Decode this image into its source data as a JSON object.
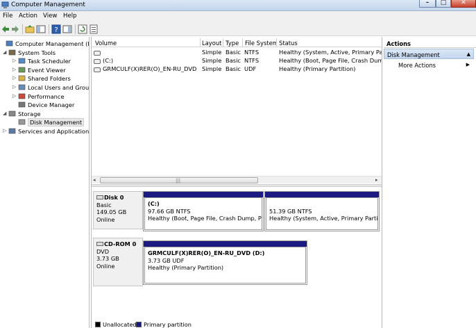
{
  "window": {
    "title": "Computer Management"
  },
  "menu": [
    "File",
    "Action",
    "View",
    "Help"
  ],
  "tree": [
    {
      "label": "Computer Management (Local",
      "level": 0,
      "icon": "computer-management-icon",
      "expander": ""
    },
    {
      "label": "System Tools",
      "level": 1,
      "icon": "system-tools-icon",
      "expander": "◢"
    },
    {
      "label": "Task Scheduler",
      "level": 2,
      "icon": "task-scheduler-icon",
      "expander": "▷"
    },
    {
      "label": "Event Viewer",
      "level": 2,
      "icon": "event-viewer-icon",
      "expander": "▷"
    },
    {
      "label": "Shared Folders",
      "level": 2,
      "icon": "shared-folders-icon",
      "expander": "▷"
    },
    {
      "label": "Local Users and Groups",
      "level": 2,
      "icon": "local-users-icon",
      "expander": "▷"
    },
    {
      "label": "Performance",
      "level": 2,
      "icon": "performance-icon",
      "expander": "▷"
    },
    {
      "label": "Device Manager",
      "level": 2,
      "icon": "device-manager-icon",
      "expander": ""
    },
    {
      "label": "Storage",
      "level": 1,
      "icon": "storage-icon",
      "expander": "◢"
    },
    {
      "label": "Disk Management",
      "level": 2,
      "icon": "disk-management-icon",
      "expander": "",
      "selected": true
    },
    {
      "label": "Services and Applications",
      "level": 1,
      "icon": "services-icon",
      "expander": "▷"
    }
  ],
  "volume_table": {
    "columns": [
      "Volume",
      "Layout",
      "Type",
      "File System",
      "Status"
    ],
    "rows": [
      {
        "volume": "",
        "layout": "Simple",
        "type": "Basic",
        "fs": "NTFS",
        "status": "Healthy (System, Active, Primary Partitic"
      },
      {
        "volume": "(C:)",
        "layout": "Simple",
        "type": "Basic",
        "fs": "NTFS",
        "status": "Healthy (Boot, Page File, Crash Dump, P"
      },
      {
        "volume": "GRMCULF(X)RER(O)_EN-RU_DVD (D:)",
        "layout": "Simple",
        "type": "Basic",
        "fs": "UDF",
        "status": "Healthy (Primary Partition)"
      }
    ]
  },
  "disks": [
    {
      "name": "Disk 0",
      "type": "Basic",
      "size": "149.05 GB",
      "state": "Online",
      "partitions": [
        {
          "name": "(C:)",
          "size": "97.66 GB NTFS",
          "status": "Healthy (Boot, Page File, Crash Dump, Prima"
        },
        {
          "name": "",
          "size": "51.39 GB NTFS",
          "status": "Healthy (System, Active, Primary Partition)"
        }
      ]
    },
    {
      "name": "CD-ROM 0",
      "type": "DVD",
      "size": "3.73 GB",
      "state": "Online",
      "partitions": [
        {
          "name": "GRMCULF(X)RER(O)_EN-RU_DVD  (D:)",
          "size": "3.73 GB UDF",
          "status": "Healthy (Primary Partition)"
        }
      ]
    }
  ],
  "legend": [
    {
      "label": "Unallocated",
      "color": "#000000"
    },
    {
      "label": "Primary partition",
      "color": "#1b1b82"
    }
  ],
  "actions": {
    "header": "Actions",
    "section": "Disk Management",
    "items": [
      "More Actions"
    ]
  }
}
